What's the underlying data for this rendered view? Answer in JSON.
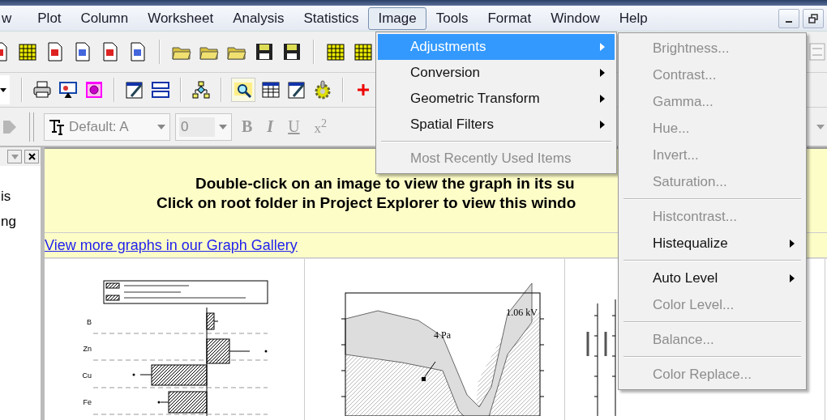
{
  "menu_bar": {
    "items": [
      {
        "label": "w",
        "selected": false
      },
      {
        "label": "Plot",
        "selected": false
      },
      {
        "label": "Column",
        "selected": false
      },
      {
        "label": "Worksheet",
        "selected": false
      },
      {
        "label": "Analysis",
        "selected": false
      },
      {
        "label": "Statistics",
        "selected": false
      },
      {
        "label": "Image",
        "selected": true
      },
      {
        "label": "Tools",
        "selected": false
      },
      {
        "label": "Format",
        "selected": false
      },
      {
        "label": "Window",
        "selected": false
      },
      {
        "label": "Help",
        "selected": false
      }
    ]
  },
  "format_toolbar": {
    "font": "Default: A",
    "size": "0",
    "styles": [
      "B",
      "I",
      "U",
      "x$^{2}$"
    ]
  },
  "project_panel": {
    "lines": [
      "is",
      "ng"
    ]
  },
  "banner": {
    "lines": [
      "Double-click on an image to view the graph in its su",
      "Click on root folder in Project Explorer to view this windo"
    ],
    "link": "View more graphs in our Graph Gallery"
  },
  "graphs": [
    {
      "kind": "bar",
      "labels": [
        "B",
        "Zn",
        "Cu",
        "Fe"
      ]
    },
    {
      "kind": "band",
      "labels": [
        "4 Pa",
        "1.06 kV"
      ]
    },
    {
      "kind": "axes"
    }
  ],
  "image_menu": {
    "items": [
      {
        "kind": "item",
        "label": "Adjustments",
        "submenu": true,
        "selected": true,
        "disabled": false
      },
      {
        "kind": "item",
        "label": "Conversion",
        "submenu": true,
        "selected": false,
        "disabled": false
      },
      {
        "kind": "item",
        "label": "Geometric Transform",
        "submenu": true,
        "selected": false,
        "disabled": false
      },
      {
        "kind": "item",
        "label": "Spatial Filters",
        "submenu": true,
        "selected": false,
        "disabled": false
      },
      {
        "kind": "separator"
      },
      {
        "kind": "item",
        "label": "Most Recently Used Items",
        "submenu": false,
        "selected": false,
        "disabled": true
      }
    ]
  },
  "adjustments_submenu": {
    "items": [
      {
        "kind": "item",
        "label": "Brightness...",
        "submenu": false,
        "selected": false,
        "disabled": true
      },
      {
        "kind": "item",
        "label": "Contrast...",
        "submenu": false,
        "selected": false,
        "disabled": true
      },
      {
        "kind": "item",
        "label": "Gamma...",
        "submenu": false,
        "selected": false,
        "disabled": true
      },
      {
        "kind": "item",
        "label": "Hue...",
        "submenu": false,
        "selected": false,
        "disabled": true
      },
      {
        "kind": "item",
        "label": "Invert...",
        "submenu": false,
        "selected": false,
        "disabled": true
      },
      {
        "kind": "item",
        "label": "Saturation...",
        "submenu": false,
        "selected": false,
        "disabled": true
      },
      {
        "kind": "separator"
      },
      {
        "kind": "item",
        "label": "Histcontrast...",
        "submenu": false,
        "selected": false,
        "disabled": true
      },
      {
        "kind": "item",
        "label": "Histequalize",
        "submenu": true,
        "selected": false,
        "disabled": false
      },
      {
        "kind": "separator"
      },
      {
        "kind": "item",
        "label": "Auto Level",
        "submenu": true,
        "selected": false,
        "disabled": false
      },
      {
        "kind": "item",
        "label": "Color Level...",
        "submenu": false,
        "selected": false,
        "disabled": true
      },
      {
        "kind": "separator"
      },
      {
        "kind": "item",
        "label": "Balance...",
        "submenu": false,
        "selected": false,
        "disabled": true
      },
      {
        "kind": "separator"
      },
      {
        "kind": "item",
        "label": "Color Replace...",
        "submenu": false,
        "selected": false,
        "disabled": true
      }
    ]
  }
}
